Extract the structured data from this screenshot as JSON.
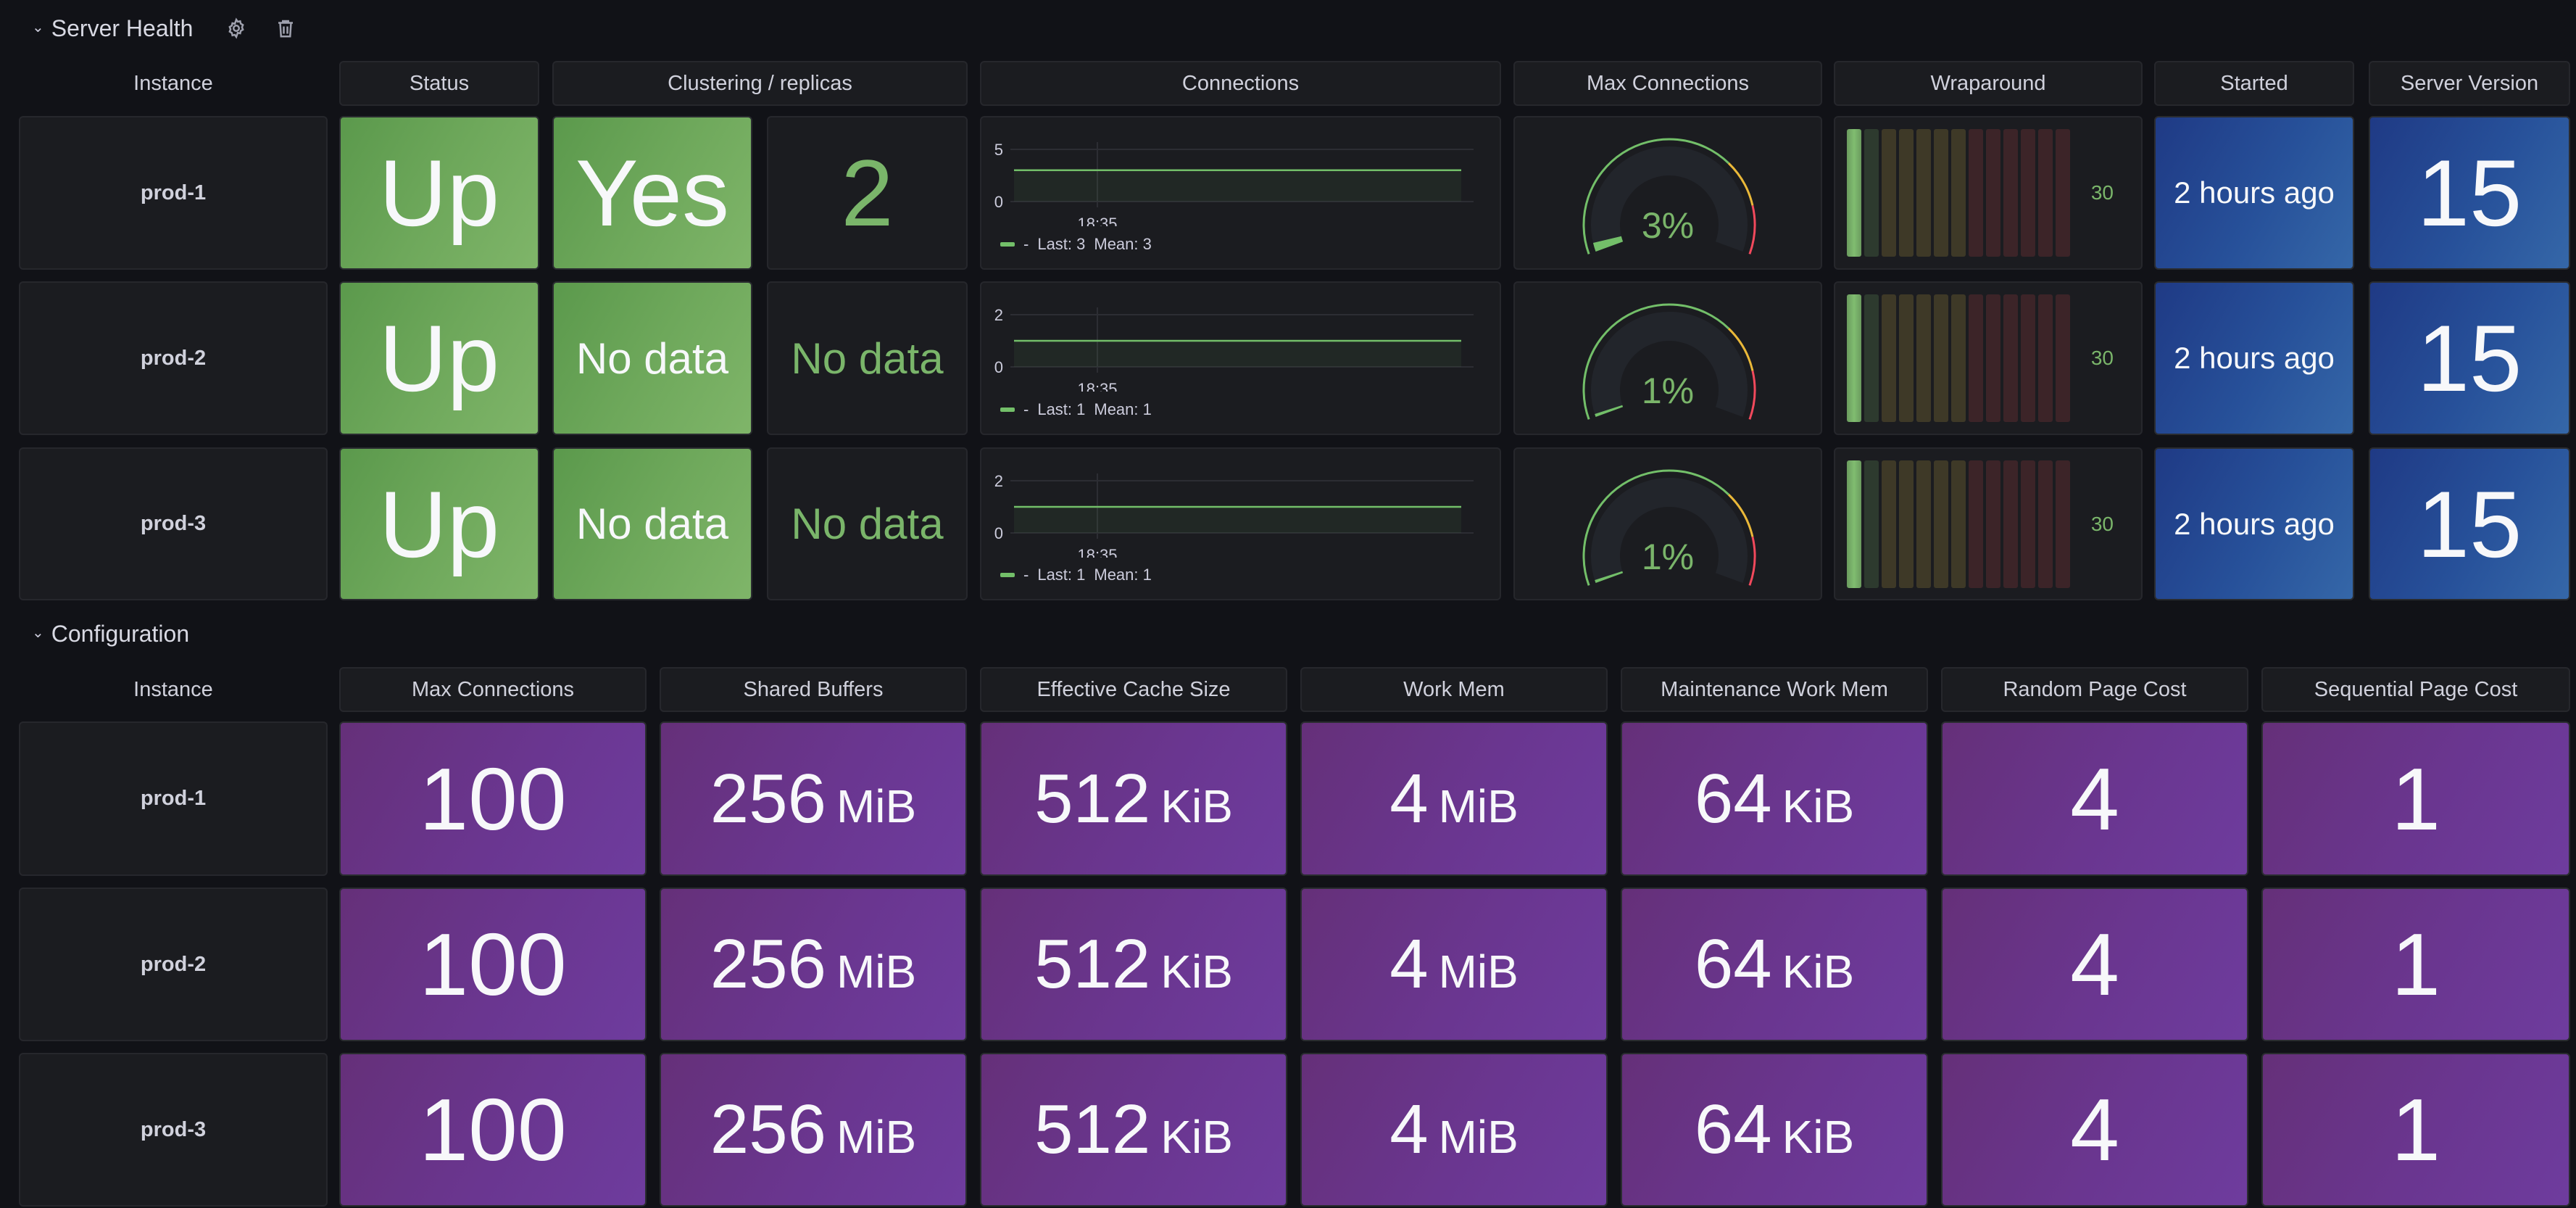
{
  "sections": {
    "server_health": {
      "title": "Server Health",
      "chevron": "chevron-down-icon",
      "actions": [
        "gear-icon",
        "trash-icon"
      ]
    },
    "configuration": {
      "title": "Configuration",
      "chevron": "chevron-down-icon"
    }
  },
  "server_health": {
    "headers": {
      "instance": "Instance",
      "status": "Status",
      "clustering": "Clustering / replicas",
      "connections": "Connections",
      "max_connections": "Max Connections",
      "wraparound": "Wraparound",
      "started": "Started",
      "server_version": "Server Version"
    },
    "rows": [
      {
        "instance": "prod-1",
        "status": "Up",
        "clustering": "Yes",
        "replicas": "2",
        "connections": {
          "y_ticks": [
            "5",
            "0"
          ],
          "y_max": 5,
          "x_tick": "18:35",
          "value": 3,
          "legend_name": "-",
          "legend_last": "Last: 3",
          "legend_mean": "Mean: 3"
        },
        "max_connections_pct": 3,
        "max_connections_label": "3%",
        "wraparound": "30",
        "wraparound_fraction": 0.077,
        "started": "2 hours ago",
        "server_version": "15"
      },
      {
        "instance": "prod-2",
        "status": "Up",
        "clustering": "No data",
        "replicas": "No data",
        "connections": {
          "y_ticks": [
            "2",
            "0"
          ],
          "y_max": 2,
          "x_tick": "18:35",
          "value": 1,
          "legend_name": "-",
          "legend_last": "Last: 1",
          "legend_mean": "Mean: 1"
        },
        "max_connections_pct": 1,
        "max_connections_label": "1%",
        "wraparound": "30",
        "wraparound_fraction": 0.077,
        "started": "2 hours ago",
        "server_version": "15"
      },
      {
        "instance": "prod-3",
        "status": "Up",
        "clustering": "No data",
        "replicas": "No data",
        "connections": {
          "y_ticks": [
            "2",
            "0"
          ],
          "y_max": 2,
          "x_tick": "18:35",
          "value": 1,
          "legend_name": "-",
          "legend_last": "Last: 1",
          "legend_mean": "Mean: 1"
        },
        "max_connections_pct": 1,
        "max_connections_label": "1%",
        "wraparound": "30",
        "wraparound_fraction": 0.077,
        "started": "2 hours ago",
        "server_version": "15"
      }
    ]
  },
  "configuration": {
    "headers": [
      "Instance",
      "Max Connections",
      "Shared Buffers",
      "Effective Cache Size",
      "Work Mem",
      "Maintenance Work Mem",
      "Random Page Cost",
      "Sequential Page Cost"
    ],
    "rows": [
      {
        "instance": "prod-1",
        "values": [
          {
            "num": "100",
            "unit": ""
          },
          {
            "num": "256",
            "unit": "MiB"
          },
          {
            "num": "512",
            "unit": "KiB"
          },
          {
            "num": "4",
            "unit": "MiB"
          },
          {
            "num": "64",
            "unit": "KiB"
          },
          {
            "num": "4",
            "unit": ""
          },
          {
            "num": "1",
            "unit": ""
          }
        ]
      },
      {
        "instance": "prod-2",
        "values": [
          {
            "num": "100",
            "unit": ""
          },
          {
            "num": "256",
            "unit": "MiB"
          },
          {
            "num": "512",
            "unit": "KiB"
          },
          {
            "num": "4",
            "unit": "MiB"
          },
          {
            "num": "64",
            "unit": "KiB"
          },
          {
            "num": "4",
            "unit": ""
          },
          {
            "num": "1",
            "unit": ""
          }
        ]
      },
      {
        "instance": "prod-3",
        "values": [
          {
            "num": "100",
            "unit": ""
          },
          {
            "num": "256",
            "unit": "MiB"
          },
          {
            "num": "512",
            "unit": "KiB"
          },
          {
            "num": "4",
            "unit": "MiB"
          },
          {
            "num": "64",
            "unit": "KiB"
          },
          {
            "num": "4",
            "unit": ""
          },
          {
            "num": "1",
            "unit": ""
          }
        ]
      }
    ]
  },
  "colors": {
    "ok_green": "#73bf69",
    "warn_yellow": "#eab839",
    "crit_red": "#f2495c",
    "stat_green": "#6ea85b",
    "stat_blue": "#27519a",
    "stat_purple": "#6a3690",
    "bg": "#111217",
    "panel_bg": "#1b1c20"
  }
}
